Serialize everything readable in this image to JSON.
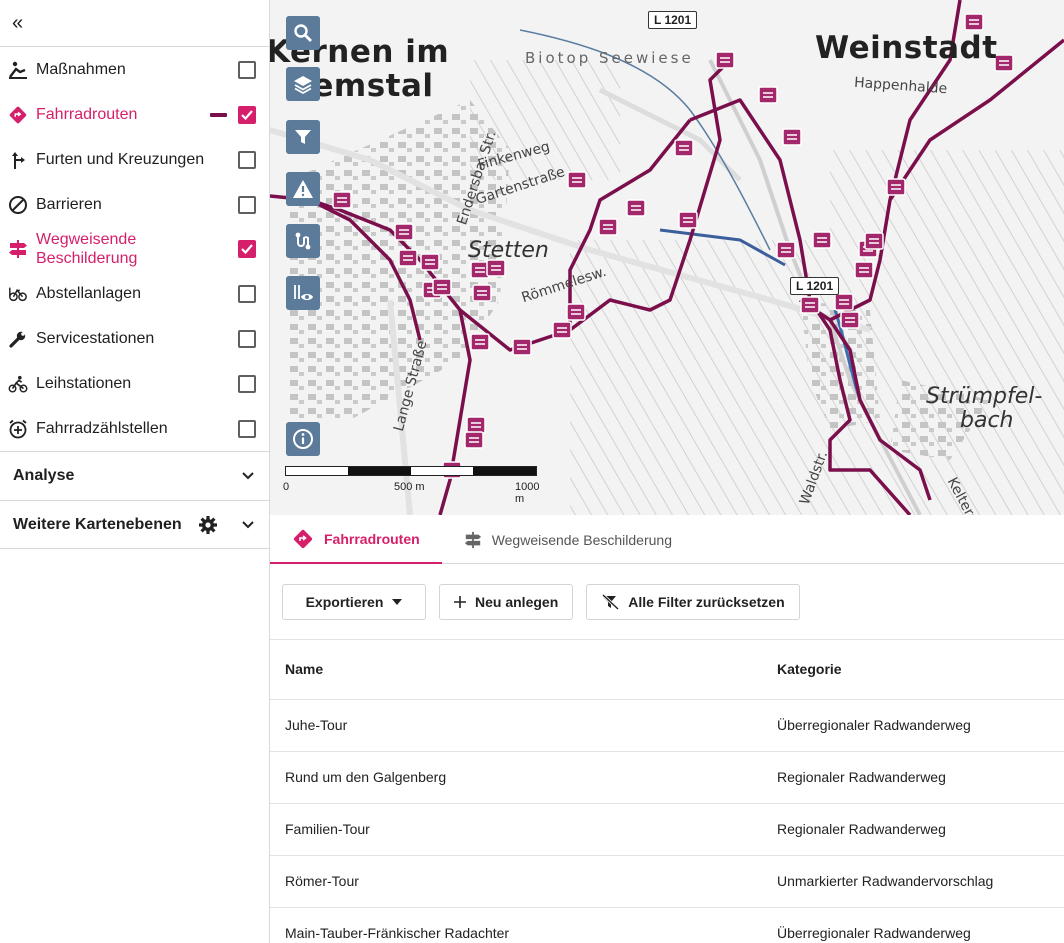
{
  "sidebar": {
    "collapse_glyph": "«",
    "layers": [
      {
        "label": "Maßnahmen",
        "icon": "construction-worker-icon",
        "checked": false
      },
      {
        "label": "Fahrradrouten",
        "icon": "route-diamond-icon",
        "checked": true,
        "legend_color": "#7a0f4c"
      },
      {
        "label": "Furten und Kreuzungen",
        "icon": "fork-arrow-icon",
        "checked": false
      },
      {
        "label": "Barrieren",
        "icon": "prohibited-icon",
        "checked": false
      },
      {
        "label": "Wegweisende Beschilderung",
        "icon": "signpost-icon",
        "checked": true
      },
      {
        "label": "Abstellanlagen",
        "icon": "parked-bicycle-icon",
        "checked": false
      },
      {
        "label": "Servicestationen",
        "icon": "wrench-icon",
        "checked": false
      },
      {
        "label": "Leihstationen",
        "icon": "bike-rider-icon",
        "checked": false
      },
      {
        "label": "Fahrradzählstellen",
        "icon": "counter-clock-icon",
        "checked": false
      }
    ],
    "sections": {
      "analyse": "Analyse",
      "more_layers": "Weitere Kartenebenen"
    }
  },
  "map": {
    "labels": {
      "kernen": "Kernen im",
      "remstal": "Remstal",
      "weinstadt": "Weinstadt",
      "stetten": "Stetten",
      "struempfel1": "Strümpfel-",
      "struempfel2": "bach",
      "biotop": "Biotop Seewiese",
      "happenhalde": "Happenhalde",
      "finkenweg": "Finkenweg",
      "gartenstrasse": "Gartenstraße",
      "endersba": "Endersba. Str.",
      "roemmelesw": "Römmelesw.",
      "lange_strasse": "Lange Straße",
      "waldstr": "Waldstr.",
      "kelter": "Kelters"
    },
    "road_badges": [
      "L 1201",
      "L 1201"
    ],
    "tool_buttons": [
      "search-icon",
      "layers-icon",
      "filter-icon",
      "warning-icon",
      "route-icon",
      "visibility-icon",
      "info-icon"
    ],
    "scale": {
      "l0": "0",
      "l500": "500 m",
      "l1000": "1000 m"
    },
    "route_color": "#7a0f4c",
    "sign_color": "#a3286b"
  },
  "panel": {
    "tabs": [
      {
        "label": "Fahrradrouten",
        "icon": "route-diamond-icon",
        "active": true
      },
      {
        "label": "Wegweisende Beschilderung",
        "icon": "signpost-icon",
        "active": false
      }
    ],
    "toolbar": {
      "export": "Exportieren",
      "new": "Neu anlegen",
      "reset": "Alle Filter zurücksetzen"
    },
    "table": {
      "headers": {
        "name": "Name",
        "category": "Kategorie"
      },
      "rows": [
        {
          "name": "Juhe-Tour",
          "category": "Überregionaler Radwanderweg"
        },
        {
          "name": "Rund um den Galgenberg",
          "category": "Regionaler Radwanderweg"
        },
        {
          "name": "Familien-Tour",
          "category": "Regionaler Radwanderweg"
        },
        {
          "name": "Römer-Tour",
          "category": "Unmarkierter Radwandervorschlag"
        },
        {
          "name": "Main-Tauber-Fränkischer Radachter",
          "category": "Überregionaler Radwanderweg"
        }
      ]
    }
  },
  "colors": {
    "accent": "#d61f6b",
    "tool_button": "#5c7a9a"
  }
}
